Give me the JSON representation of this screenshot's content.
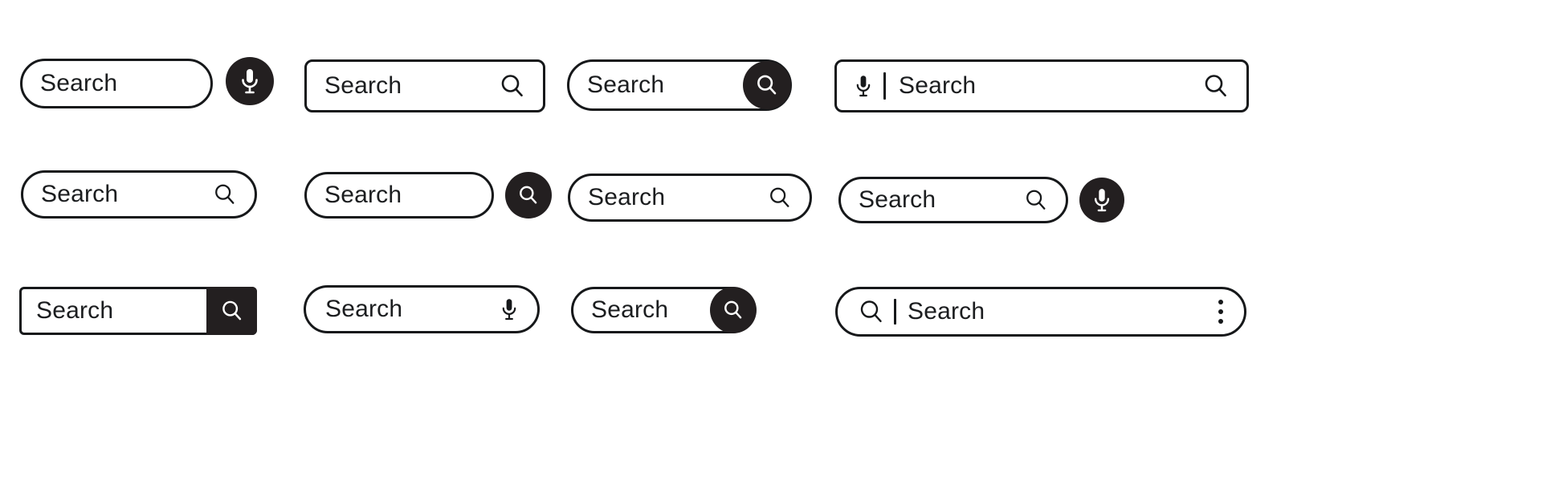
{
  "page": {
    "title": "Search Bar UI Element Set",
    "background_color": "#ffffff",
    "ink_color": "#16181a",
    "fill_color": "#231f20",
    "icon_on_fill_color": "#ffffff"
  },
  "rows": [
    {
      "row_index": 1,
      "items": [
        {
          "id": "r1c1",
          "shape": "pill",
          "placeholder": "Search",
          "text_value": "Search",
          "leading_icon": null,
          "trailing_icon": null,
          "external_button": {
            "shape": "circle",
            "icon": "microphone-icon",
            "filled": true
          }
        },
        {
          "id": "r1c2",
          "shape": "rounded-rectangle",
          "placeholder": "Search",
          "text_value": "Search",
          "leading_icon": null,
          "trailing_icon": "search-icon",
          "external_button": null
        },
        {
          "id": "r1c3",
          "shape": "pill",
          "placeholder": "Search",
          "text_value": "Search",
          "leading_icon": null,
          "trailing_icon": null,
          "overlay_button": {
            "shape": "circle",
            "icon": "search-icon",
            "filled": true
          }
        },
        {
          "id": "r1c4",
          "shape": "rounded-rectangle",
          "placeholder": "Search",
          "text_value": "Search",
          "leading_icon": "microphone-icon",
          "has_divider": true,
          "trailing_icon": "search-icon",
          "external_button": null
        }
      ]
    },
    {
      "row_index": 2,
      "items": [
        {
          "id": "r2c1",
          "shape": "pill",
          "placeholder": "Search",
          "text_value": "Search",
          "leading_icon": null,
          "trailing_icon": "search-icon",
          "external_button": null
        },
        {
          "id": "r2c2",
          "shape": "pill",
          "placeholder": "Search",
          "text_value": "Search",
          "leading_icon": null,
          "trailing_icon": null,
          "external_button": {
            "shape": "circle",
            "icon": "search-icon",
            "filled": true
          }
        },
        {
          "id": "r2c3",
          "shape": "pill",
          "placeholder": "Search",
          "text_value": "Search",
          "leading_icon": null,
          "trailing_icon": "search-icon",
          "external_button": null
        },
        {
          "id": "r2c4",
          "shape": "pill",
          "placeholder": "Search",
          "text_value": "Search",
          "leading_icon": null,
          "trailing_icon": "search-icon",
          "external_button": {
            "shape": "circle",
            "icon": "microphone-icon",
            "filled": true
          }
        }
      ]
    },
    {
      "row_index": 3,
      "items": [
        {
          "id": "r3c1",
          "shape": "rounded-rectangle",
          "placeholder": "Search",
          "text_value": "Search",
          "leading_icon": null,
          "trailing_icon": null,
          "overlay_button": {
            "shape": "block",
            "icon": "search-icon",
            "filled": true
          }
        },
        {
          "id": "r3c2",
          "shape": "pill",
          "placeholder": "Search",
          "text_value": "Search",
          "leading_icon": null,
          "trailing_icon": "microphone-icon",
          "external_button": null
        },
        {
          "id": "r3c3",
          "shape": "pill",
          "placeholder": "Search",
          "text_value": "Search",
          "leading_icon": null,
          "trailing_icon": null,
          "overlay_button": {
            "shape": "circle",
            "icon": "search-icon",
            "filled": true
          }
        },
        {
          "id": "r3c4",
          "shape": "pill",
          "placeholder": "Search",
          "text_value": "Search",
          "leading_icon": "search-icon",
          "has_divider": true,
          "trailing_icon": "more-vertical-icon",
          "external_button": null
        }
      ]
    }
  ],
  "labels": {
    "search_1_1": "Search",
    "search_1_2": "Search",
    "search_1_3": "Search",
    "search_1_4": "Search",
    "search_2_1": "Search",
    "search_2_2": "Search",
    "search_2_3": "Search",
    "search_2_4": "Search",
    "search_3_1": "Search",
    "search_3_2": "Search",
    "search_3_3": "Search",
    "search_3_4": "Search"
  }
}
